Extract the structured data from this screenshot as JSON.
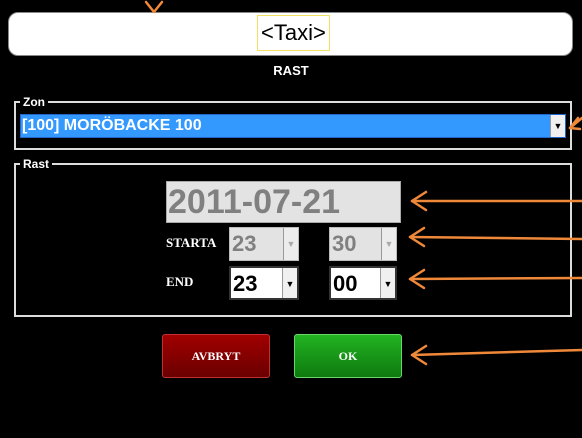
{
  "header": {
    "title": "<Taxi>",
    "subtitle": "RAST"
  },
  "zon": {
    "legend": "Zon",
    "selected": "[100] MORÖBACKE 100"
  },
  "rast": {
    "legend": "Rast",
    "date": "2011-07-21",
    "start_label": "STARTA",
    "start_hour": "23",
    "start_minute": "30",
    "end_label": "END",
    "end_hour": "23",
    "end_minute": "00"
  },
  "buttons": {
    "cancel": "AVBRYT",
    "ok": "OK"
  },
  "colors": {
    "annotation_arrow": "#f0883a",
    "selection": "#3399ff",
    "cancel": "#8b0000",
    "ok": "#14a014"
  },
  "icons": {
    "dropdown": "chevron-down-icon",
    "annotation": "arrow-left-icon"
  }
}
